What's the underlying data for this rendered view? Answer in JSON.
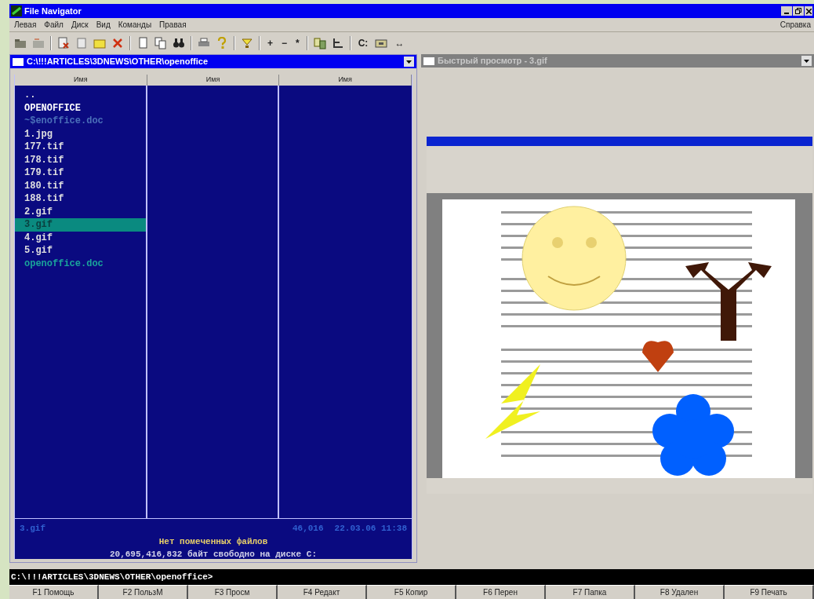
{
  "window": {
    "title": "File Navigator"
  },
  "menu": [
    "Левая",
    "Файл",
    "Диск",
    "Вид",
    "Команды",
    "Правая"
  ],
  "menu_right": "Справка",
  "toolbar": [
    {
      "kind": "icon"
    },
    {
      "kind": "icon"
    },
    {
      "kind": "sep"
    },
    {
      "kind": "icon"
    },
    {
      "kind": "icon"
    },
    {
      "kind": "icon"
    },
    {
      "kind": "icon"
    },
    {
      "kind": "sep"
    },
    {
      "kind": "icon"
    },
    {
      "kind": "icon"
    },
    {
      "kind": "icon"
    },
    {
      "kind": "sep"
    },
    {
      "kind": "icon"
    },
    {
      "kind": "icon"
    },
    {
      "kind": "sep"
    },
    {
      "kind": "icon"
    },
    {
      "kind": "sep"
    },
    {
      "kind": "text",
      "label": "+"
    },
    {
      "kind": "text",
      "label": "−"
    },
    {
      "kind": "text",
      "label": "*"
    },
    {
      "kind": "sep"
    },
    {
      "kind": "icon"
    },
    {
      "kind": "icon"
    },
    {
      "kind": "sep"
    },
    {
      "kind": "text",
      "label": "C:"
    },
    {
      "kind": "icon"
    },
    {
      "kind": "text",
      "label": "↔"
    }
  ],
  "left_panel": {
    "path": "C:\\!!!ARTICLES\\3DNEWS\\OTHER\\openoffice",
    "columns": [
      "Имя",
      "Имя",
      "Имя"
    ],
    "files": [
      {
        "name": "..",
        "kind": "file",
        "selected": false
      },
      {
        "name": "OPENOFFICE",
        "kind": "dir",
        "selected": false
      },
      {
        "name": "~$enoffice.doc",
        "kind": "hidden",
        "selected": false
      },
      {
        "name": "1.jpg",
        "kind": "file",
        "selected": false
      },
      {
        "name": "177.tif",
        "kind": "file",
        "selected": false
      },
      {
        "name": "178.tif",
        "kind": "file",
        "selected": false
      },
      {
        "name": "179.tif",
        "kind": "file",
        "selected": false
      },
      {
        "name": "180.tif",
        "kind": "file",
        "selected": false
      },
      {
        "name": "188.tif",
        "kind": "file",
        "selected": false
      },
      {
        "name": "2.gif",
        "kind": "file",
        "selected": false
      },
      {
        "name": "3.gif",
        "kind": "file",
        "selected": true
      },
      {
        "name": "4.gif",
        "kind": "file",
        "selected": false
      },
      {
        "name": "5.gif",
        "kind": "file",
        "selected": false
      },
      {
        "name": "openoffice.doc",
        "kind": "document",
        "selected": false
      }
    ],
    "status": {
      "file": "3.gif",
      "size": "46,016",
      "date": "22.03.06 11:38",
      "marked": "Нет помеченных файлов",
      "free": "20,695,416,832 байт свободно на диске C:"
    }
  },
  "right_panel": {
    "title": "Быстрый просмотр - 3.gif"
  },
  "command_line": "C:\\!!!ARTICLES\\3DNEWS\\OTHER\\openoffice>",
  "function_keys": [
    "F1 Помощь",
    "F2 ПользМ",
    "F3 Просм",
    "F4 Редакт",
    "F5 Копир",
    "F6 Перен",
    "F7 Папка",
    "F8 Удален",
    "F9 Печать"
  ]
}
